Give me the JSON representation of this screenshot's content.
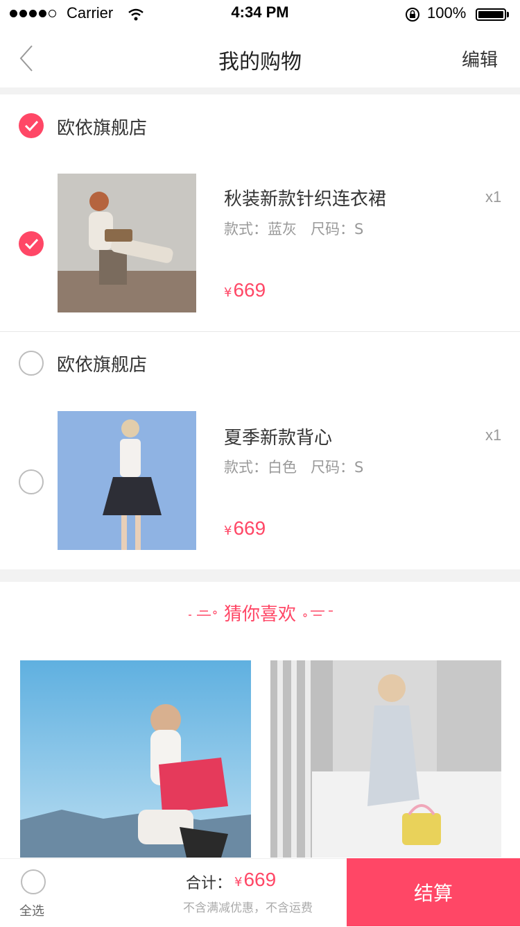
{
  "status_bar": {
    "carrier": "Carrier",
    "time": "4:34 PM",
    "battery": "100%"
  },
  "nav": {
    "title": "我的购物",
    "edit_label": "编辑"
  },
  "cart": {
    "shops": [
      {
        "name": "欧依旗舰店",
        "checked": true,
        "item": {
          "title": "秋装新款针织连衣裙",
          "quantity": "x1",
          "spec": "款式：蓝灰   尺码：S",
          "currency": "¥",
          "price": "669",
          "checked": true
        }
      },
      {
        "name": "欧依旗舰店",
        "checked": false,
        "item": {
          "title": "夏季新款背心",
          "quantity": "x1",
          "spec": "款式：白色   尺码：S",
          "currency": "¥",
          "price": "669",
          "checked": false
        }
      }
    ]
  },
  "recommend": {
    "title": "猜你喜欢"
  },
  "bottom_bar": {
    "select_all": "全选",
    "total_label": "合计：",
    "currency": "¥",
    "total_price": "669",
    "note": "不含满减优惠，不含运费",
    "checkout_label": "结算"
  },
  "colors": {
    "accent": "#ff4766",
    "divider": "#f2f2f2"
  }
}
